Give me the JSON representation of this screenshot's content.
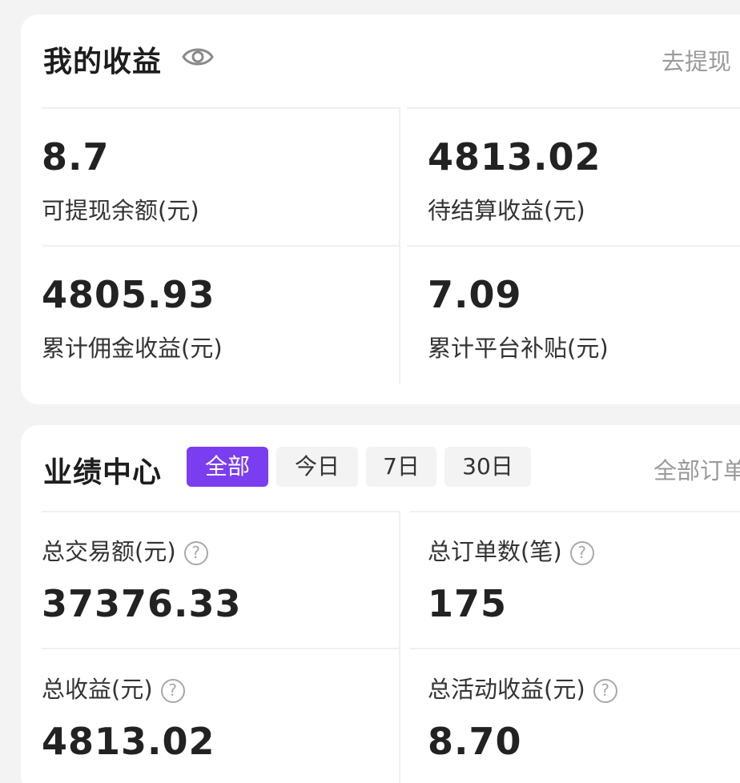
{
  "earnings": {
    "title": "我的收益",
    "withdraw_link": "去提现",
    "stats": [
      {
        "value": "8.7",
        "label": "可提现余额(元)"
      },
      {
        "value": "4813.02",
        "label": "待结算收益(元)"
      },
      {
        "value": "4805.93",
        "label": "累计佣金收益(元)"
      },
      {
        "value": "7.09",
        "label": "累计平台补贴(元)"
      }
    ]
  },
  "performance": {
    "title": "业绩中心",
    "tabs": [
      "全部",
      "今日",
      "7日",
      "30日"
    ],
    "active_tab": "全部",
    "all_orders_link": "全部订单",
    "stats": [
      {
        "label": "总交易额(元)",
        "value": "37376.33"
      },
      {
        "label": "总订单数(笔)",
        "value": "175"
      },
      {
        "label": "总收益(元)",
        "value": "4813.02"
      },
      {
        "label": "总活动收益(元)",
        "value": "8.70"
      }
    ]
  },
  "icons": {
    "eye": "eye-icon",
    "help": "question-circle-icon"
  },
  "colors": {
    "accent": "#7a3ef0",
    "muted": "#9a9a9a"
  }
}
